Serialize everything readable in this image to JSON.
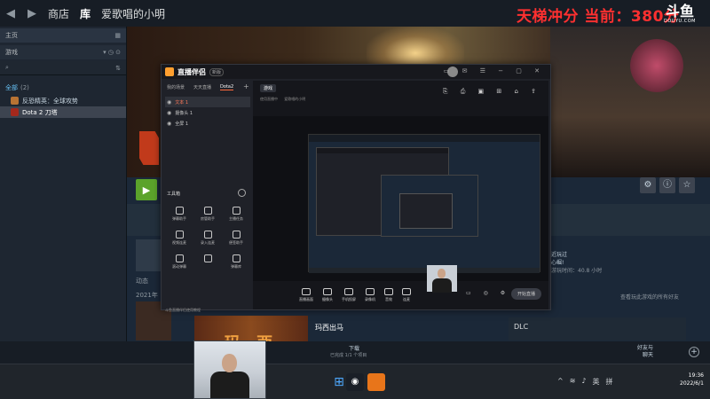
{
  "window": {
    "tabs": [
      "商店",
      "库",
      "爱歌唱的小明"
    ],
    "active_tab_index": 1
  },
  "overlay": {
    "banner_text": "天梯冲分 当前：380分",
    "logo_text": "斗鱼",
    "logo_sub": "DOUYU.COM"
  },
  "sidebar": {
    "home_label": "主页",
    "games_label": "游戏",
    "section_label": "全部",
    "section_count": "(2)",
    "games": [
      {
        "name": "反恐精英：全球攻势",
        "selected": false
      },
      {
        "name": "Dota 2 刀塔",
        "selected": true
      }
    ]
  },
  "main": {
    "activity_label": "动态",
    "year_label": "2021年",
    "right_info": {
      "title": "近玩过",
      "subtitle": "心崛!",
      "hours": "游玩时间：40.8 小时",
      "link": "查看玩此游戏的所有好友"
    },
    "news_title": "玛西出马",
    "news_big": "玛 西",
    "dlc_label": "DLC"
  },
  "steambar": {
    "download_label": "下载",
    "download_status": "已完成 1/1 个项目",
    "friends_label": "好友与\n聊天"
  },
  "taskbar": {
    "tray_items": [
      "英",
      "拼"
    ],
    "clock_time": "19:36",
    "clock_date": "2022/6/1"
  },
  "streamapp": {
    "title": "直播伴侣",
    "badge": "新版",
    "tabs": [
      "我的场景",
      "天天直播",
      "Dota2"
    ],
    "active_tab": 2,
    "scenes": [
      {
        "label": "文本 1",
        "active": true
      },
      {
        "label": "摄像头 1",
        "active": false
      },
      {
        "label": "全屏 1",
        "active": false
      }
    ],
    "toolbox_label": "工具箱",
    "tools": [
      "弹幕助手",
      "房管助手",
      "主播任务",
      "视频连麦",
      "录入连麦",
      "便签助手",
      "滚动弹幕",
      "",
      "弹幕库"
    ],
    "bottom_link": "斗鱼直播伴侣使用教程",
    "center_pill": "游戏",
    "center_sub": "使用直播中",
    "center_sub2": "爱歌唱的小明",
    "controls": [
      "直播画面",
      "摄像头",
      "手机投屏",
      "录像机",
      "音效",
      "连麦",
      "轨道"
    ],
    "start_button": "开始直播"
  }
}
